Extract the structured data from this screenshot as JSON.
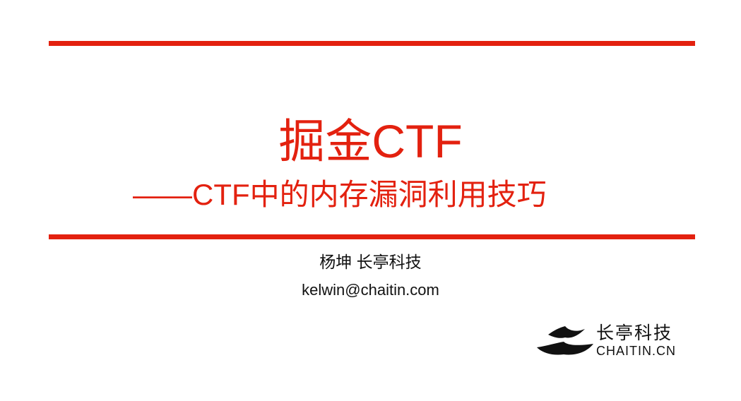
{
  "slide": {
    "title": "掘金CTF",
    "subtitle": "——CTF中的内存漏洞利用技巧",
    "author": "杨坤 长亭科技",
    "email": "kelwin@chaitin.com"
  },
  "logo": {
    "name_cn": "长亭科技",
    "name_en": "CHAITIN.CN"
  },
  "colors": {
    "accent": "#e3210f",
    "text": "#111111",
    "background": "#ffffff"
  }
}
